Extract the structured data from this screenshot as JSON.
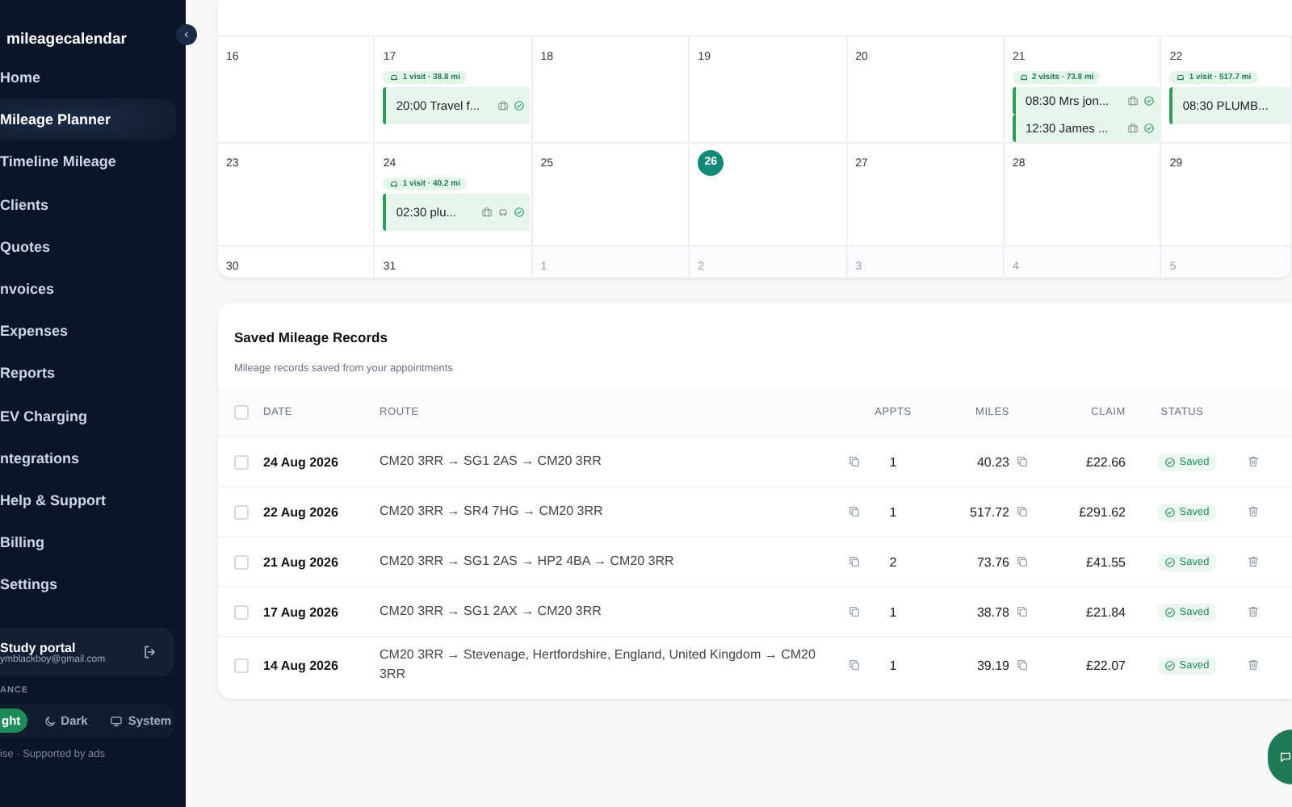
{
  "sidebar": {
    "brand": "mileagecalendar",
    "items": [
      {
        "label": "Home",
        "selected": false
      },
      {
        "label": "Mileage Planner",
        "selected": true
      },
      {
        "label": "Timeline Mileage",
        "selected": false
      },
      {
        "label": "Clients",
        "selected": false
      },
      {
        "label": "Quotes",
        "selected": false
      },
      {
        "label": "nvoices",
        "selected": false
      },
      {
        "label": "Expenses",
        "selected": false
      },
      {
        "label": "Reports",
        "selected": false
      },
      {
        "label": "EV Charging",
        "selected": false
      },
      {
        "label": "ntegrations",
        "selected": false
      },
      {
        "label": "Help & Support",
        "selected": false
      },
      {
        "label": "Billing",
        "selected": false
      },
      {
        "label": "Settings",
        "selected": false
      }
    ],
    "user": {
      "name": "Study portal",
      "email": "ymblackboy@gmail.com"
    },
    "appearance_label": "ANCE",
    "themes": [
      {
        "label": "ght",
        "kind": "sun",
        "selected": true
      },
      {
        "label": "Dark",
        "kind": "moon",
        "selected": false
      },
      {
        "label": "System",
        "kind": "monitor",
        "selected": false
      }
    ],
    "footer": "ise · Supported by ads"
  },
  "calendar": {
    "weeks": [
      {
        "days": [
          {
            "date": "16",
            "in_month": true,
            "today": false
          },
          {
            "date": "17",
            "in_month": true,
            "today": false,
            "summary": "1 visit · 38.8 mi",
            "events": [
              {
                "time": "20:00",
                "title": "Travel f...",
                "travel": false,
                "done": true
              }
            ]
          },
          {
            "date": "18",
            "in_month": true,
            "today": false
          },
          {
            "date": "19",
            "in_month": true,
            "today": false
          },
          {
            "date": "20",
            "in_month": true,
            "today": false
          },
          {
            "date": "21",
            "in_month": true,
            "today": false,
            "summary": "2 visits · 73.8 mi",
            "events": [
              {
                "time": "08:30",
                "title": "Mrs jon...",
                "travel": false,
                "done": true
              },
              {
                "time": "12:30",
                "title": "James ...",
                "travel": false,
                "done": true
              }
            ]
          },
          {
            "date": "22",
            "in_month": true,
            "today": false,
            "summary": "1 visit · 517.7 mi",
            "events": [
              {
                "time": "08:30",
                "title": "PLUMB...",
                "travel": false
              }
            ]
          }
        ]
      },
      {
        "days": [
          {
            "date": "23",
            "in_month": true,
            "today": false
          },
          {
            "date": "24",
            "in_month": true,
            "today": false,
            "summary": "1 visit · 40.2 mi",
            "events": [
              {
                "time": "02:30",
                "title": "plu...",
                "travel": true,
                "done": true
              }
            ]
          },
          {
            "date": "25",
            "in_month": true,
            "today": false
          },
          {
            "date": "26",
            "in_month": true,
            "today": true
          },
          {
            "date": "27",
            "in_month": true,
            "today": false
          },
          {
            "date": "28",
            "in_month": true,
            "today": false
          },
          {
            "date": "29",
            "in_month": true,
            "today": false
          }
        ]
      },
      {
        "days": [
          {
            "date": "30",
            "in_month": true,
            "today": false
          },
          {
            "date": "31",
            "in_month": true,
            "today": false
          },
          {
            "date": "1",
            "in_month": false,
            "today": false
          },
          {
            "date": "2",
            "in_month": false,
            "today": false
          },
          {
            "date": "3",
            "in_month": false,
            "today": false
          },
          {
            "date": "4",
            "in_month": false,
            "today": false
          },
          {
            "date": "5",
            "in_month": false,
            "today": false
          }
        ]
      }
    ]
  },
  "records": {
    "title": "Saved Mileage Records",
    "subtitle": "Mileage records saved from your appointments",
    "all_checked": false,
    "columns": [
      "DATE",
      "ROUTE",
      "APPTS",
      "MILES",
      "CLAIM",
      "STATUS"
    ],
    "rows": [
      {
        "checked": false,
        "date": "24 Aug 2026",
        "route": "CM20 3RR → SG1 2AS → CM20 3RR",
        "appts": "1",
        "miles": "40.23",
        "claim": "£22.66",
        "status": "Saved"
      },
      {
        "checked": false,
        "date": "22 Aug 2026",
        "route": "CM20 3RR → SR4 7HG → CM20 3RR",
        "appts": "1",
        "miles": "517.72",
        "claim": "£291.62",
        "status": "Saved"
      },
      {
        "checked": false,
        "date": "21 Aug 2026",
        "route": "CM20 3RR → SG1 2AS → HP2 4BA → CM20 3RR",
        "appts": "2",
        "miles": "73.76",
        "claim": "£41.55",
        "status": "Saved"
      },
      {
        "checked": false,
        "date": "17 Aug 2026",
        "route": "CM20 3RR → SG1 2AX → CM20 3RR",
        "appts": "1",
        "miles": "38.78",
        "claim": "£21.84",
        "status": "Saved"
      },
      {
        "checked": false,
        "date": "14 Aug 2026",
        "route": "CM20 3RR → Stevenage, Hertfordshire, England, United Kingdom → CM20 3RR",
        "appts": "1",
        "miles": "39.19",
        "claim": "£22.07",
        "status": "Saved"
      }
    ]
  }
}
